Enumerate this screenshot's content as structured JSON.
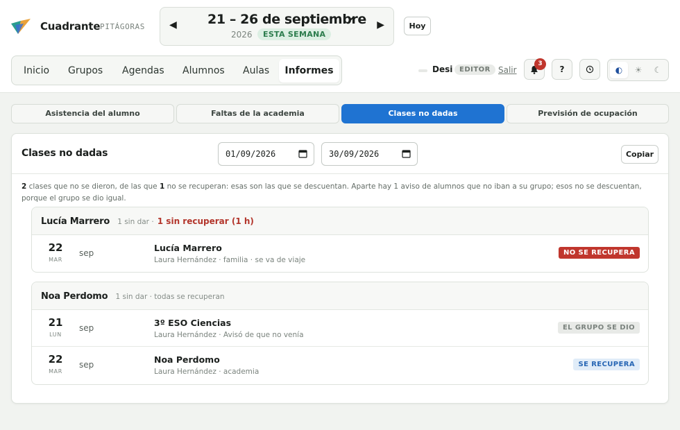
{
  "app": {
    "name": "Cuadrante",
    "subtitle": "PITÁGORAS"
  },
  "week": {
    "title": "21 – 26 de septiembre",
    "year": "2026",
    "badge": "ESTA SEMANA",
    "today_label": "Hoy"
  },
  "nav": {
    "items": [
      "Inicio",
      "Grupos",
      "Agendas",
      "Alumnos",
      "Aulas",
      "Informes"
    ],
    "active": "Informes"
  },
  "user": {
    "name": "Desi",
    "role": "EDITOR",
    "logout": "Salir"
  },
  "notifications": {
    "count": "3"
  },
  "help_label": "?",
  "report_tabs": {
    "items": [
      "Asistencia del alumno",
      "Faltas de la academia",
      "Clases no dadas",
      "Previsión de ocupación"
    ],
    "active": "Clases no dadas"
  },
  "report": {
    "title": "Clases no dadas",
    "date_from": "01/09/2026",
    "date_to": "30/09/2026",
    "copy_label": "Copiar",
    "summary": {
      "n1": "2",
      "t1": " clases que no se dieron, de las que ",
      "n2": "1",
      "t2": " no se recuperan: esas son las que se descuentan. Aparte hay 1 aviso de alumnos que no iban a su grupo; esos no se descuentan, porque el grupo se dio igual."
    },
    "groups": [
      {
        "name": "Lucía Marrero",
        "meta": "1 sin dar ·",
        "alert": "1 sin recuperar (1 h)",
        "rows": [
          {
            "day": "22",
            "dow": "MAR",
            "month": "sep",
            "title": "Lucía Marrero",
            "sub": "Laura Hernández · familia · se va de viaje",
            "status": "NO SE RECUPERA"
          }
        ]
      },
      {
        "name": "Noa Perdomo",
        "meta": "1 sin dar · todas se recuperan",
        "rows": [
          {
            "day": "21",
            "dow": "LUN",
            "month": "sep",
            "title": "3º ESO Ciencias",
            "sub": "Laura Hernández · Avisó de que no venía",
            "status": "EL GRUPO SE DIO"
          },
          {
            "day": "22",
            "dow": "MAR",
            "month": "sep",
            "title": "Noa Perdomo",
            "sub": "Laura Hernández · academia",
            "status": "SE RECUPERA"
          }
        ]
      }
    ]
  },
  "colors": {
    "accent": "#1f73d2",
    "danger": "#c0362d",
    "success_bg": "#dcefe3",
    "info_bg": "#e0ecf8"
  },
  "icons": [
    "app-logo-icon",
    "chevron-left-icon",
    "chevron-right-icon",
    "chevron-down-icon",
    "bell-icon",
    "clock-icon",
    "contrast-icon",
    "sun-icon",
    "moon-icon",
    "calendar-icon"
  ]
}
